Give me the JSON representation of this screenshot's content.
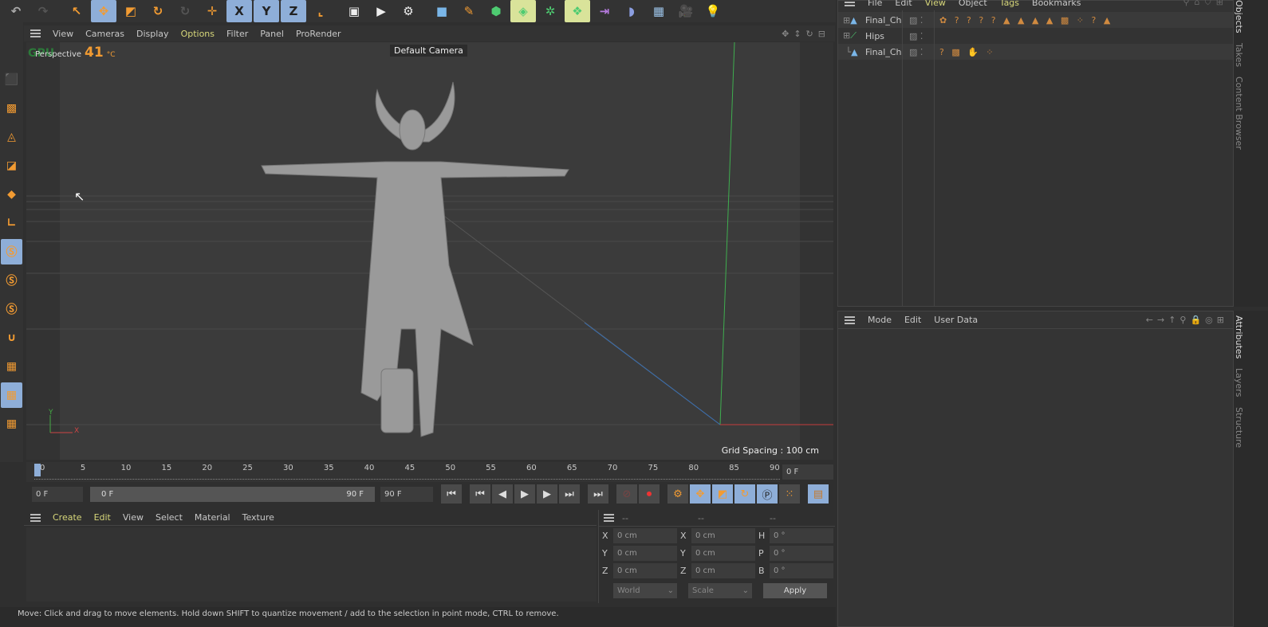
{
  "toolbar": {
    "items": [
      {
        "name": "undo-icon",
        "glyph": "↶",
        "color": "#aaa"
      },
      {
        "name": "redo-icon",
        "glyph": "↷",
        "color": "#555"
      },
      {
        "name": "live-selection-icon",
        "glyph": "↖",
        "color": "#f29b32"
      },
      {
        "name": "move-tool-icon",
        "glyph": "✥",
        "color": "#f29b32",
        "sel": true
      },
      {
        "name": "scale-tool-icon",
        "glyph": "◩",
        "color": "#f29b32"
      },
      {
        "name": "rotate-tool-icon",
        "glyph": "↻",
        "color": "#f29b32"
      },
      {
        "name": "recent-tools-icon",
        "glyph": "↻",
        "color": "#555"
      },
      {
        "name": "world-axis-icon",
        "glyph": "✛",
        "color": "#f29b32"
      },
      {
        "name": "x-axis-lock-icon",
        "glyph": "X",
        "color": "#222",
        "sel": true
      },
      {
        "name": "y-axis-lock-icon",
        "glyph": "Y",
        "color": "#222",
        "sel": true
      },
      {
        "name": "z-axis-lock-icon",
        "glyph": "Z",
        "color": "#222",
        "sel": true
      },
      {
        "name": "coordinate-system-icon",
        "glyph": "⌞",
        "color": "#f29b32"
      },
      {
        "name": "render-view-icon",
        "glyph": "▣",
        "color": "#eee"
      },
      {
        "name": "render-picture-viewer-icon",
        "glyph": "▶",
        "color": "#eee"
      },
      {
        "name": "render-settings-icon",
        "glyph": "⚙",
        "color": "#eee"
      },
      {
        "name": "cube-icon",
        "glyph": "■",
        "color": "#7ab6e8"
      },
      {
        "name": "pen-icon",
        "glyph": "✎",
        "color": "#f29b32"
      },
      {
        "name": "subdivision-icon",
        "glyph": "⬢",
        "color": "#4ecb71"
      },
      {
        "name": "generator-icon",
        "glyph": "◈",
        "color": "#4ecb71",
        "yel": true
      },
      {
        "name": "array-icon",
        "glyph": "✲",
        "color": "#4ecb71"
      },
      {
        "name": "cloner-icon",
        "glyph": "❖",
        "color": "#4ecb71",
        "yel": true
      },
      {
        "name": "deformer-icon",
        "glyph": "⇥",
        "color": "#b77be0"
      },
      {
        "name": "field-icon",
        "glyph": "◗",
        "color": "#8b9ee0"
      },
      {
        "name": "floor-icon",
        "glyph": "▦",
        "color": "#9cc3e8"
      },
      {
        "name": "camera-icon",
        "glyph": "🎥",
        "color": "#eee"
      },
      {
        "name": "light-icon",
        "glyph": "💡",
        "color": "#eee"
      }
    ]
  },
  "viewport": {
    "menu": [
      "View",
      "Cameras",
      "Display",
      "Options",
      "Filter",
      "Panel",
      "ProRender"
    ],
    "projection": "Perspective",
    "gpu_label": "GPU",
    "temperature": "41",
    "temp_unit": "°C",
    "camera": "Default Camera",
    "grid_spacing": "Grid Spacing : 100 cm",
    "axis_x": "X",
    "axis_y": "Y"
  },
  "timeline": {
    "ticks": [
      "0",
      "5",
      "10",
      "15",
      "20",
      "25",
      "30",
      "35",
      "40",
      "45",
      "50",
      "55",
      "60",
      "65",
      "70",
      "75",
      "80",
      "85",
      "90"
    ],
    "current_frame": "0 F",
    "start": "0 F",
    "range_start": "0 F",
    "range_end": "90 F",
    "end": "90 F",
    "current_field": "0 F"
  },
  "material_manager": {
    "menu": [
      "Create",
      "Edit",
      "View",
      "Select",
      "Material",
      "Texture"
    ]
  },
  "coordinates": {
    "headers": [
      "--",
      "--",
      "--"
    ],
    "rows": [
      {
        "l1": "X",
        "v1": "0 cm",
        "l2": "X",
        "v2": "0 cm",
        "l3": "H",
        "v3": "0 °"
      },
      {
        "l1": "Y",
        "v1": "0 cm",
        "l2": "Y",
        "v2": "0 cm",
        "l3": "P",
        "v3": "0 °"
      },
      {
        "l1": "Z",
        "v1": "0 cm",
        "l2": "Z",
        "v2": "0 cm",
        "l3": "B",
        "v3": "0 °"
      }
    ],
    "space": "World",
    "mode": "Scale",
    "apply": "Apply"
  },
  "status": "Move: Click and drag to move elements. Hold down SHIFT to quantize movement / add to the selection in point mode, CTRL to remove.",
  "objects": {
    "menu": [
      "File",
      "Edit",
      "View",
      "Object",
      "Tags",
      "Bookmarks"
    ],
    "items": [
      {
        "name": "Final_Ch",
        "tags": "✿ ? ? ? ? ▲ ▲ ▲ ▲ ▩ ⁘ ? ▲"
      },
      {
        "name": "Hips",
        "tags": ""
      },
      {
        "name": "Final_Ch",
        "tags": "? ▩ ✋ ⁘"
      }
    ]
  },
  "attributes": {
    "menu": [
      "Mode",
      "Edit",
      "User Data"
    ]
  },
  "side_tabs_top": [
    "Objects",
    "Takes",
    "Content Browser"
  ],
  "side_tabs_bottom": [
    "Attributes",
    "Layers",
    "Structure"
  ],
  "colors": {
    "accent": "#f29b32",
    "selected": "#8eaed8",
    "menu_highlight": "#d7d77a"
  }
}
